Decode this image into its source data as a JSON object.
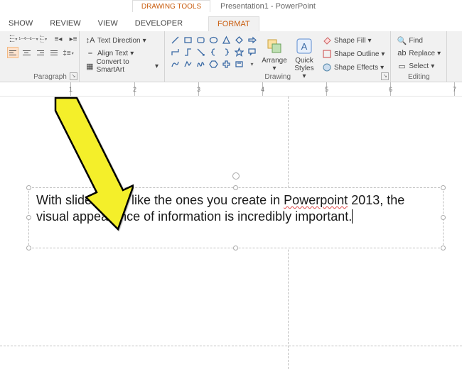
{
  "title": {
    "context_tab": "DRAWING TOOLS",
    "app": "Presentation1 - PowerPoint"
  },
  "tabs": [
    "SHOW",
    "REVIEW",
    "VIEW",
    "DEVELOPER",
    "FORMAT"
  ],
  "active_tab": "FORMAT",
  "paragraph": {
    "label": "Paragraph",
    "text_direction": "Text Direction",
    "align_text": "Align Text",
    "convert_smartart": "Convert to SmartArt"
  },
  "drawing": {
    "label": "Drawing",
    "arrange": "Arrange",
    "quick_styles": "Quick\nStyles",
    "shape_fill": "Shape Fill",
    "shape_outline": "Shape Outline",
    "shape_effects": "Shape Effects"
  },
  "editing": {
    "label": "Editing",
    "find": "Find",
    "replace": "Replace",
    "select": "Select"
  },
  "ruler_numbers": [
    "1",
    "2",
    "3",
    "4",
    "5",
    "6",
    "7"
  ],
  "textbox": {
    "content_before": "With slideshows like the ones you create in ",
    "error_word": "Powerpoint",
    "content_after": " 2013, the visual appearance of information is incredibly important."
  }
}
